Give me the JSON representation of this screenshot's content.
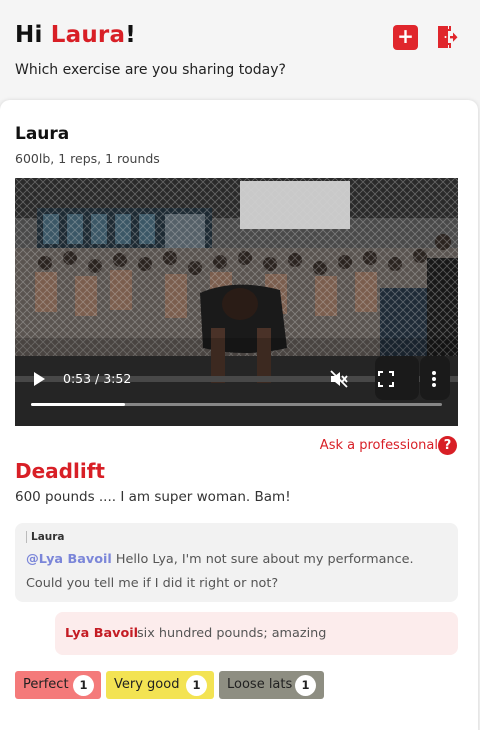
{
  "header": {
    "greeting_prefix": "Hi",
    "user_name": "Laura",
    "greeting_suffix": "!",
    "subtitle": "Which exercise are you sharing today?",
    "add_icon": "plus-icon",
    "logout_icon": "logout-icon"
  },
  "post": {
    "author": "Laura",
    "stats": "600lb, 1 reps, 1 rounds",
    "video": {
      "time": "0:53 / 3:52",
      "progress": 0.228
    },
    "ask_professional": "Ask a professional",
    "help_glyph": "?",
    "exercise": "Deadlift",
    "description": "600 pounds .... I am super woman. Bam!",
    "comment": {
      "author": "Laura",
      "mention": "@Lya Bavoil",
      "text": " Hello Lya, I'm not sure about my performance. Could you tell me if I did it right or not?"
    },
    "reply": {
      "author": "Lya Bavoil",
      "text": "six hundred pounds; amazing"
    },
    "reactions": [
      {
        "label": "Perfect",
        "count": "1",
        "color": "#f47a7a"
      },
      {
        "label": "Very good",
        "count": "1",
        "color": "#f3e353"
      },
      {
        "label": "Loose lats",
        "count": "1",
        "color": "#8e8e82"
      }
    ]
  },
  "colors": {
    "accent": "#d81f26",
    "mention": "#7b86d9",
    "reply_bg": "#fcecec"
  }
}
